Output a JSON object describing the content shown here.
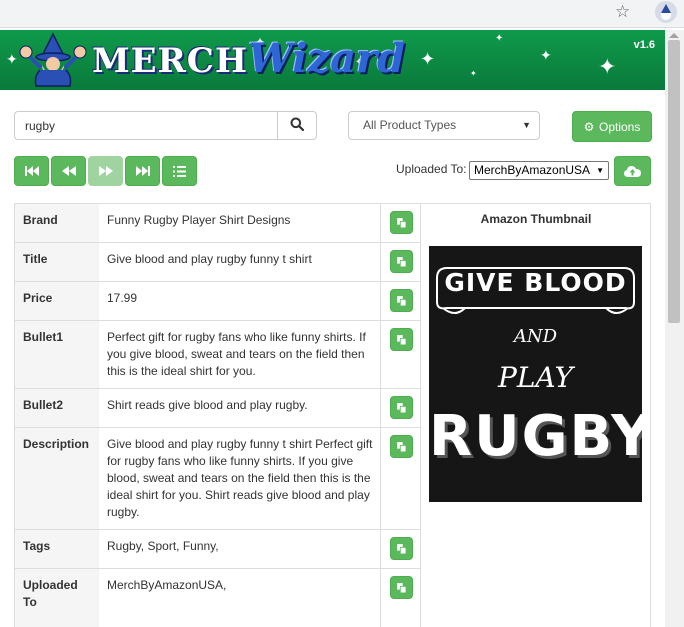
{
  "browser": {
    "bookmark_icon": "star-icon",
    "extension_icon": "wizard-icon"
  },
  "header": {
    "logo_word_1": "MERCH",
    "logo_word_2": "Wizard",
    "version": "v1.6"
  },
  "search": {
    "value": "rugby",
    "placeholder": ""
  },
  "product_type": {
    "selected": "All Product Types"
  },
  "options_label": "Options",
  "upload": {
    "label": "Uploaded To:",
    "selected": "MerchByAmazonUSA"
  },
  "fields": [
    {
      "label": "Brand",
      "value": "Funny Rugby Player Shirt Designs"
    },
    {
      "label": "Title",
      "value": "Give blood and play rugby funny t shirt"
    },
    {
      "label": "Price",
      "value": "17.99"
    },
    {
      "label": "Bullet1",
      "value": "Perfect gift for rugby fans who like funny shirts. If you give blood, sweat and tears on the field then this is the ideal shirt for you."
    },
    {
      "label": "Bullet2",
      "value": "Shirt reads give blood and play rugby."
    },
    {
      "label": "Description",
      "value": "Give blood and play rugby funny t shirt Perfect gift for rugby fans who like funny shirts. If you give blood, sweat and tears on the field then this is the ideal shirt for you. Shirt reads give blood and play rugby."
    },
    {
      "label": "Tags",
      "value": "Rugby, Sport, Funny,"
    },
    {
      "label": "Uploaded To",
      "value": "MerchByAmazonUSA,"
    }
  ],
  "thumbnail": {
    "header": "Amazon Thumbnail",
    "line1": "GIVE BLOOD",
    "line2": "AND",
    "line3": "PLAY",
    "line4": "RUGBY"
  },
  "colors": {
    "banner": "#0a7a3b",
    "button": "#5cb85c",
    "logo_blue": "#2f66d6"
  }
}
